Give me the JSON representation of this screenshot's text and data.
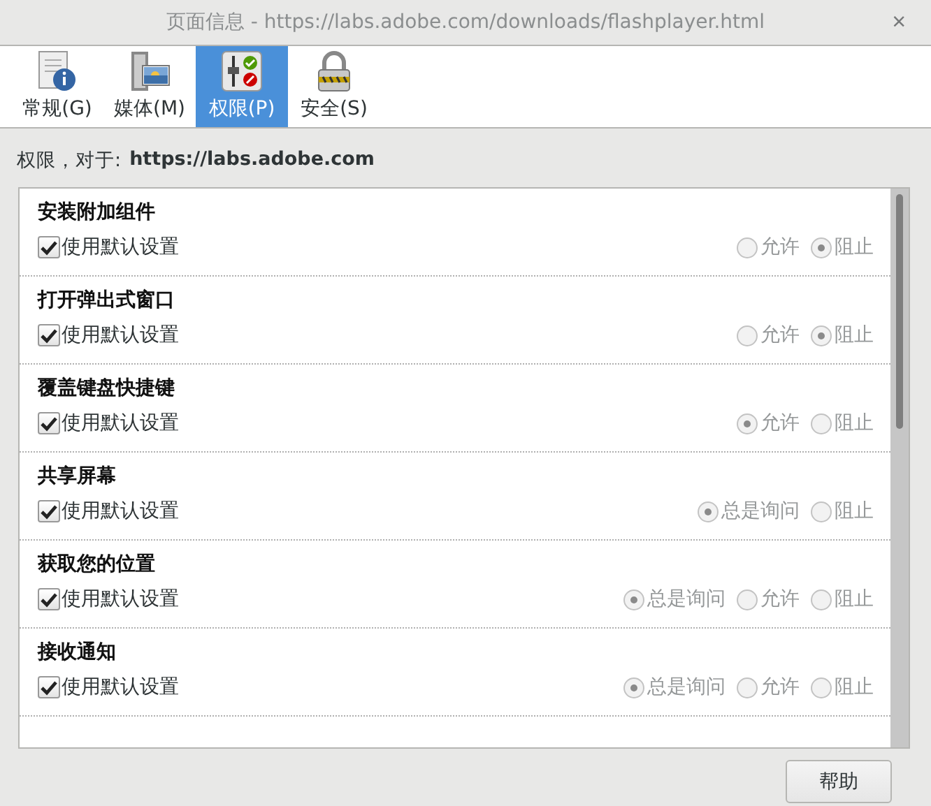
{
  "window": {
    "title": "页面信息 - https://labs.adobe.com/downloads/flashplayer.html",
    "close": "×"
  },
  "tabs": [
    {
      "label": "常规(G)",
      "kind": "general",
      "selected": false
    },
    {
      "label": "媒体(M)",
      "kind": "media",
      "selected": false
    },
    {
      "label": "权限(P)",
      "kind": "permissions",
      "selected": true
    },
    {
      "label": "安全(S)",
      "kind": "security",
      "selected": false
    }
  ],
  "permissions_for": {
    "label": "权限，对于:",
    "site": "https://labs.adobe.com"
  },
  "permissions": [
    {
      "title": "安装附加组件",
      "default": {
        "label": "使用默认设置",
        "checked": true
      },
      "options": [
        {
          "label": "允许",
          "selected": false
        },
        {
          "label": "阻止",
          "selected": true
        }
      ]
    },
    {
      "title": "打开弹出式窗口",
      "default": {
        "label": "使用默认设置",
        "checked": true
      },
      "options": [
        {
          "label": "允许",
          "selected": false
        },
        {
          "label": "阻止",
          "selected": true
        }
      ]
    },
    {
      "title": "覆盖键盘快捷键",
      "default": {
        "label": "使用默认设置",
        "checked": true
      },
      "options": [
        {
          "label": "允许",
          "selected": true
        },
        {
          "label": "阻止",
          "selected": false
        }
      ]
    },
    {
      "title": "共享屏幕",
      "default": {
        "label": "使用默认设置",
        "checked": true
      },
      "options": [
        {
          "label": "总是询问",
          "selected": true
        },
        {
          "label": "阻止",
          "selected": false
        }
      ]
    },
    {
      "title": "获取您的位置",
      "default": {
        "label": "使用默认设置",
        "checked": true
      },
      "options": [
        {
          "label": "总是询问",
          "selected": true
        },
        {
          "label": "允许",
          "selected": false
        },
        {
          "label": "阻止",
          "selected": false
        }
      ]
    },
    {
      "title": "接收通知",
      "default": {
        "label": "使用默认设置",
        "checked": true
      },
      "options": [
        {
          "label": "总是询问",
          "selected": true
        },
        {
          "label": "允许",
          "selected": false
        },
        {
          "label": "阻止",
          "selected": false
        }
      ]
    }
  ],
  "buttons": [
    {
      "label": "帮助"
    }
  ]
}
